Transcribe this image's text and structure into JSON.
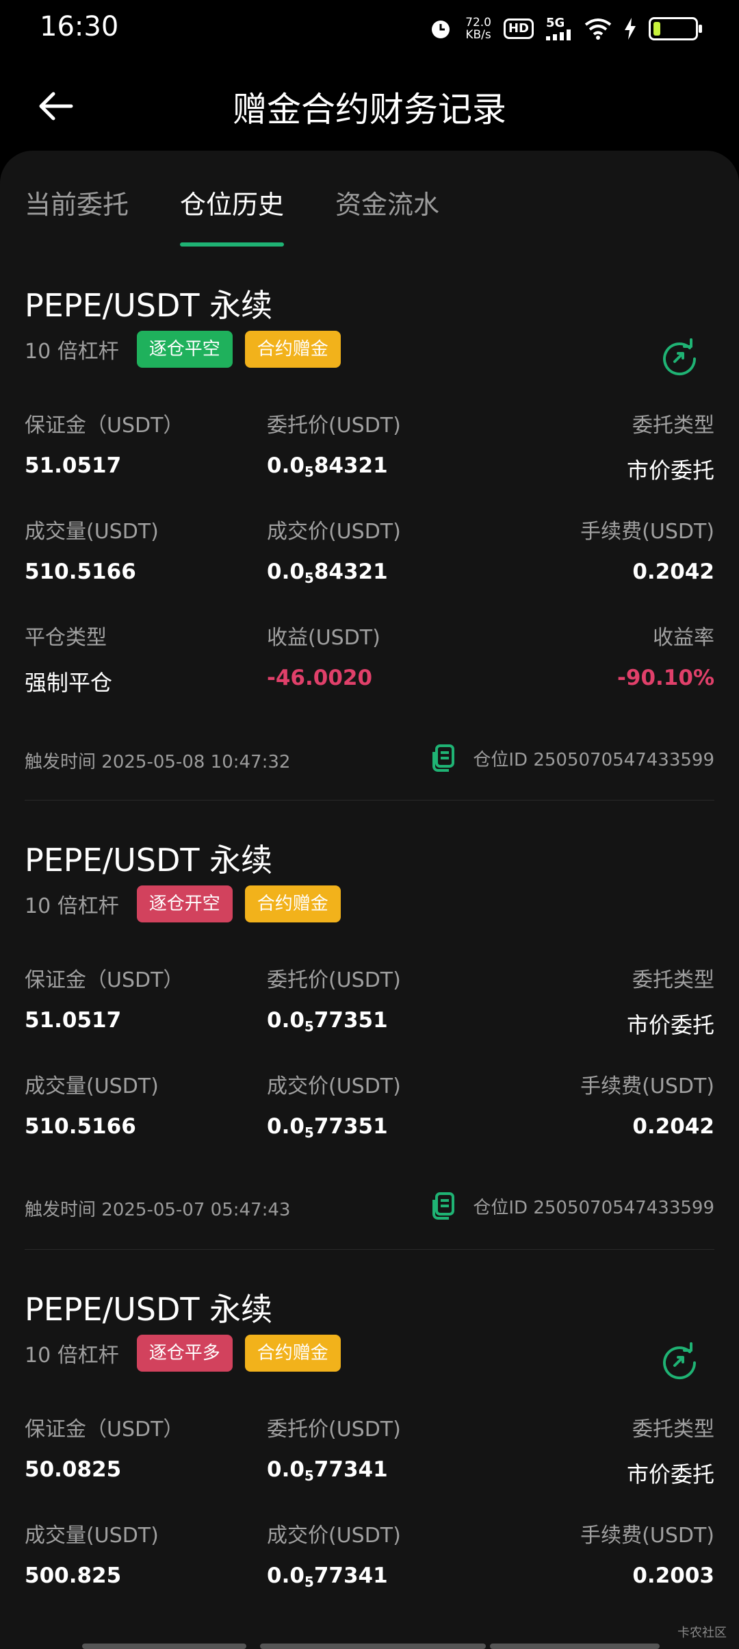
{
  "status": {
    "time": "16:30",
    "speed_value": "72.0",
    "speed_unit": "KB/s",
    "hd": "HD",
    "network": "5G"
  },
  "header": {
    "title": "赠金合约财务记录"
  },
  "tabs": [
    {
      "label": "当前委托",
      "active": false
    },
    {
      "label": "仓位历史",
      "active": true
    },
    {
      "label": "资金流水",
      "active": false
    }
  ],
  "labels": {
    "margin": "保证金（USDT）",
    "order_price": "委托价(USDT)",
    "order_type": "委托类型",
    "volume": "成交量(USDT)",
    "fill_price": "成交价(USDT)",
    "fee": "手续费(USDT)",
    "close_type": "平仓类型",
    "pnl": "收益(USDT)",
    "pnl_rate": "收益率",
    "trigger_prefix": "触发时间",
    "position_prefix": "仓位ID"
  },
  "records": [
    {
      "pair": "PEPE/USDT 永续",
      "leverage": "10 倍杠杆",
      "side_badge": "逐仓平空",
      "side_color": "#1fb15c",
      "bonus_badge": "合约赠金",
      "margin": "51.0517",
      "order_price": {
        "lead": "0.0",
        "zeros": "5",
        "tail": "84321"
      },
      "order_type": "市价委托",
      "volume": "510.5166",
      "fill_price": {
        "lead": "0.0",
        "zeros": "5",
        "tail": "84321"
      },
      "fee": "0.2042",
      "close_type": "强制平仓",
      "pnl": "-46.0020",
      "pnl_rate": "-90.10%",
      "trigger_time": "2025-05-08 10:47:32",
      "position_id": "2505070547433599"
    },
    {
      "pair": "PEPE/USDT 永续",
      "leverage": "10 倍杠杆",
      "side_badge": "逐仓开空",
      "side_color": "#d2425d",
      "bonus_badge": "合约赠金",
      "margin": "51.0517",
      "order_price": {
        "lead": "0.0",
        "zeros": "5",
        "tail": "77351"
      },
      "order_type": "市价委托",
      "volume": "510.5166",
      "fill_price": {
        "lead": "0.0",
        "zeros": "5",
        "tail": "77351"
      },
      "fee": "0.2042",
      "trigger_time": "2025-05-07 05:47:43",
      "position_id": "2505070547433599"
    },
    {
      "pair": "PEPE/USDT 永续",
      "leverage": "10 倍杠杆",
      "side_badge": "逐仓平多",
      "side_color": "#d2425d",
      "bonus_badge": "合约赠金",
      "margin": "50.0825",
      "order_price": {
        "lead": "0.0",
        "zeros": "5",
        "tail": "77341"
      },
      "order_type": "市价委托",
      "volume": "500.825",
      "fill_price": {
        "lead": "0.0",
        "zeros": "5",
        "tail": "77341"
      },
      "fee": "0.2003"
    }
  ],
  "watermark": "卡农社区",
  "colors": {
    "accent": "#1fb374",
    "negative": "#e0406a",
    "gold": "#f2b21b"
  }
}
